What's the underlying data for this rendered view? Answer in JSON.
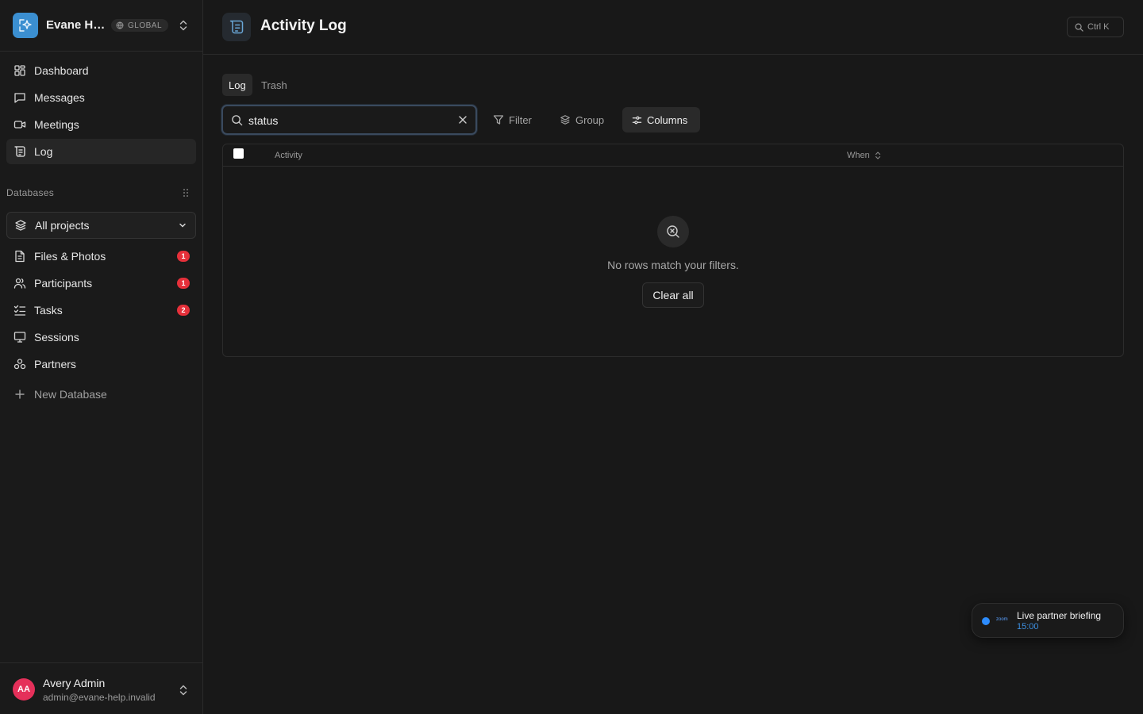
{
  "workspace": {
    "name": "Evane Help Desk",
    "badge": "GLOBAL"
  },
  "nav": [
    {
      "label": "Dashboard",
      "icon": "dashboard-icon"
    },
    {
      "label": "Messages",
      "icon": "message-icon"
    },
    {
      "label": "Meetings",
      "icon": "video-icon"
    },
    {
      "label": "Log",
      "icon": "log-icon",
      "active": true
    }
  ],
  "databases": {
    "section_label": "Databases",
    "project_select": "All projects",
    "items": [
      {
        "label": "Files & Photos",
        "icon": "file-icon",
        "badge": "1"
      },
      {
        "label": "Participants",
        "icon": "users-icon",
        "badge": "1"
      },
      {
        "label": "Tasks",
        "icon": "checklist-icon",
        "badge": "2"
      },
      {
        "label": "Sessions",
        "icon": "presentation-icon"
      },
      {
        "label": "Partners",
        "icon": "partners-icon"
      }
    ],
    "new_label": "New Database"
  },
  "user": {
    "initials": "AA",
    "name": "Avery Admin",
    "email": "admin@evane-help.invalid"
  },
  "header": {
    "title": "Activity Log",
    "shortcut": "Ctrl K"
  },
  "tabs": [
    {
      "label": "Log",
      "active": true
    },
    {
      "label": "Trash",
      "active": false
    }
  ],
  "search": {
    "value": "status"
  },
  "toolbar": {
    "filter": "Filter",
    "group": "Group",
    "columns": "Columns"
  },
  "table": {
    "columns": [
      "Activity",
      "When"
    ],
    "empty_text": "No rows match your filters.",
    "clear_label": "Clear all"
  },
  "toast": {
    "brand": "zoom",
    "title": "Live partner briefing",
    "time": "15:00"
  },
  "colors": {
    "accent": "#3b8fd1",
    "badge": "#e5303a",
    "avatar": "#e5305a",
    "toast_dot": "#2d8cff"
  }
}
